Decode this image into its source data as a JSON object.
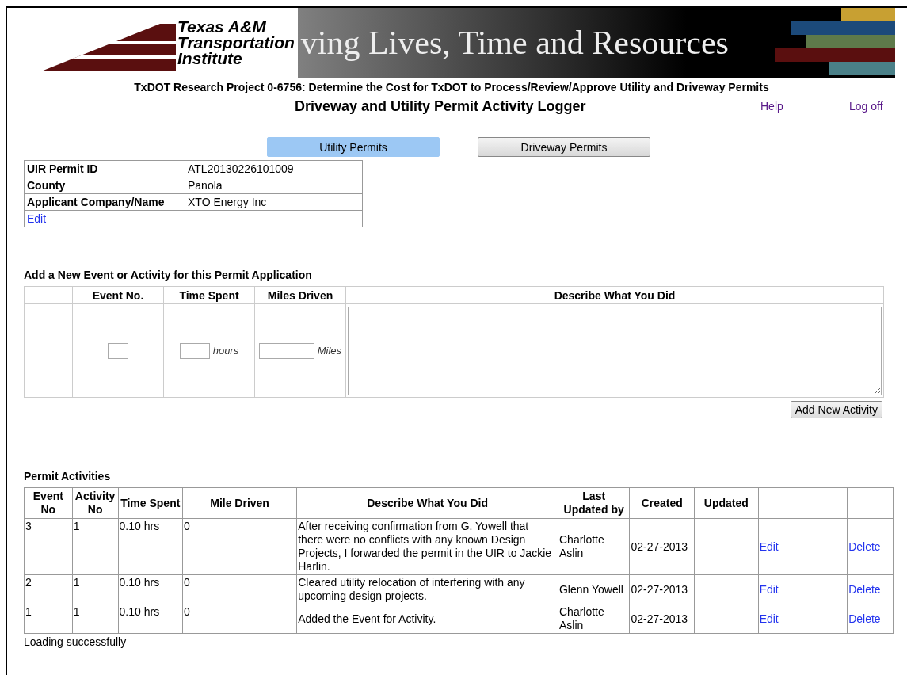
{
  "banner": {
    "logo_lines": [
      "Texas A&M",
      "Transportation",
      "Institute"
    ],
    "slogan": "ving Lives, Time and Resources"
  },
  "project_title": "TxDOT Research Project 0-6756: Determine the Cost for TxDOT to Process/Review/Approve Utility and Driveway Permits",
  "app_title": "Driveway and Utility Permit Activity Logger",
  "nav_links": [
    "Help",
    "Log off"
  ],
  "tabs": [
    {
      "label": "Utility Permits",
      "selected": true
    },
    {
      "label": "Driveway Permits",
      "selected": false
    }
  ],
  "permit_info": {
    "rows": [
      {
        "label": "UIR Permit ID",
        "value": "ATL20130226101009"
      },
      {
        "label": "County",
        "value": "Panola"
      },
      {
        "label": "Applicant Company/Name",
        "value": "XTO Energy Inc"
      }
    ],
    "edit_link": "Edit"
  },
  "new_event": {
    "heading": "Add a New Event or Activity for this Permit Application",
    "columns": [
      "Event No.",
      "Time Spent",
      "Miles Driven",
      "Describe What You Did"
    ],
    "hours_unit": "hours",
    "miles_unit": "Miles",
    "button": "Add New Activity"
  },
  "activities": {
    "heading": "Permit Activities",
    "columns": [
      "Event No",
      "Activity No",
      "Time Spent",
      "Mile Driven",
      "Describe What You Did",
      "Last Updated by",
      "Created",
      "Updated"
    ],
    "rows": [
      {
        "event_no": "3",
        "activity_no": "1",
        "time_spent": "0.10 hrs",
        "mile_driven": "0",
        "description": "After receiving confirmation from G. Yowell that there were no conflicts with any known Design Projects, I forwarded the permit in the UIR to Jackie Harlin.",
        "last_updated_by": "Charlotte Aslin",
        "created": "02-27-2013",
        "edit": "Edit",
        "delete": "Delete"
      },
      {
        "event_no": "2",
        "activity_no": "1",
        "time_spent": "0.10 hrs",
        "mile_driven": "0",
        "description": "Cleared utility relocation of interfering with any upcoming design projects.",
        "last_updated_by": "Glenn Yowell",
        "created": "02-27-2013",
        "edit": "Edit",
        "delete": "Delete"
      },
      {
        "event_no": "1",
        "activity_no": "1",
        "time_spent": "0.10 hrs",
        "mile_driven": "0",
        "description": "Added the Event for Activity.",
        "last_updated_by": "Charlotte Aslin",
        "created": "02-27-2013",
        "edit": "Edit",
        "delete": "Delete"
      }
    ]
  },
  "status": "Loading successfully"
}
